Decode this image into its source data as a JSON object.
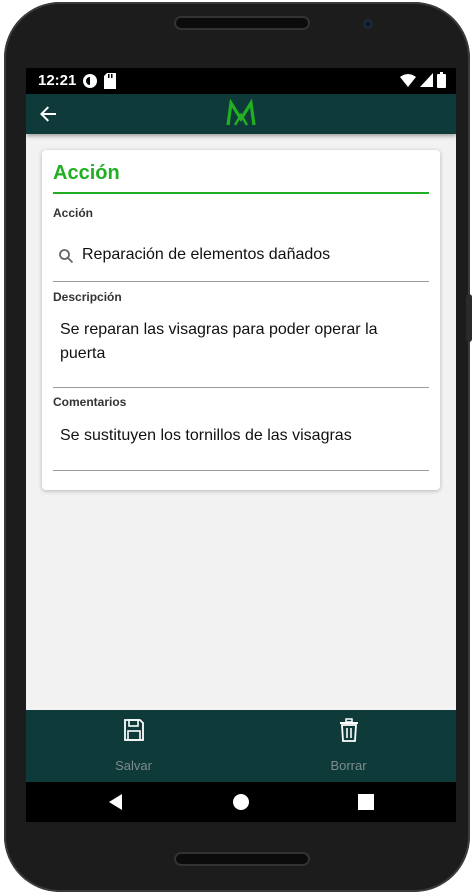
{
  "status_bar": {
    "time": "12:21"
  },
  "app_bar": {
    "back_icon": "arrow-left-icon",
    "logo": "M"
  },
  "card": {
    "title": "Acción",
    "fields": {
      "accion": {
        "label": "Acción",
        "value": "Reparación de elementos dañados"
      },
      "descripcion": {
        "label": "Descripción",
        "value_line1": "Se reparan las visagras para poder operar la",
        "value_line2": "puerta"
      },
      "comentarios": {
        "label": "Comentarios",
        "value": "Se sustituyen los tornillos de las visagras"
      }
    }
  },
  "bottom_bar": {
    "save": {
      "label": "Salvar",
      "icon": "floppy-disk-icon"
    },
    "delete": {
      "label": "Borrar",
      "icon": "trash-icon"
    }
  },
  "colors": {
    "accent": "#22b022",
    "appbar": "#0f3a3a",
    "background": "#f2f2f2"
  }
}
